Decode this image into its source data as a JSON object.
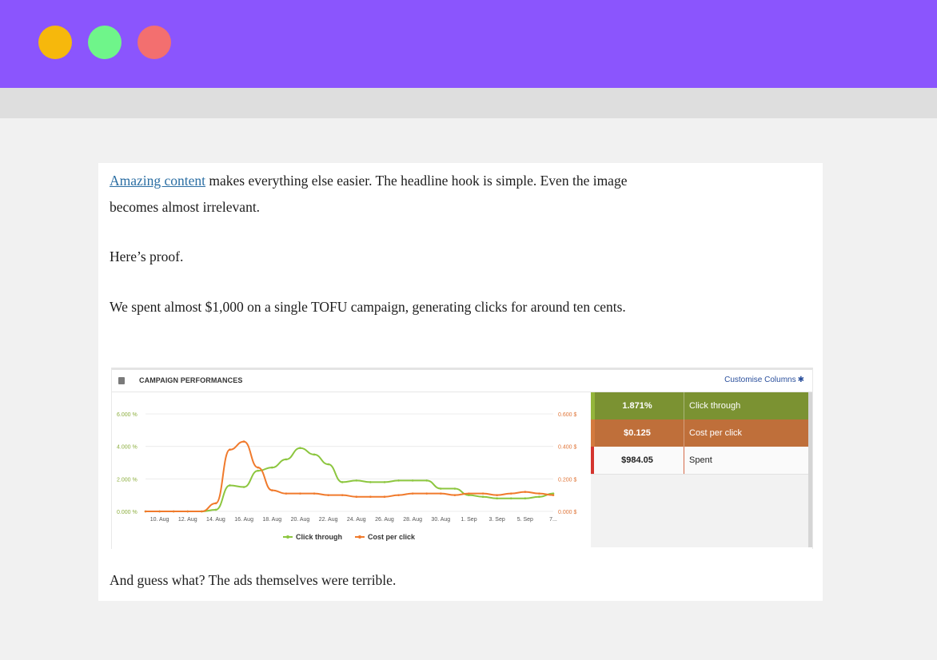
{
  "window": {
    "colors": {
      "titlebar": "#8b55fd",
      "dot_yellow": "#f6b80c",
      "dot_green": "#6ff58a",
      "dot_red": "#f36f6f",
      "toolbar": "#dedede",
      "page": "#f1f1f1"
    }
  },
  "article": {
    "p1_link": "Amazing content",
    "p1_rest": " makes everything else easier. The headline hook is simple. Even the image becomes almost irrelevant.",
    "p2": "Here’s proof.",
    "p3": "We spent almost $1,000 on a single TOFU campaign, generating clicks for around ten cents.",
    "p4": "And guess what? The ads themselves were terrible."
  },
  "widget": {
    "title": "CAMPAIGN PERFORMANCES",
    "customise_label": "Customise Columns",
    "icons": {
      "facebook": "facebook-icon",
      "gear": "gear-icon"
    },
    "metrics": [
      {
        "value": "1.871%",
        "label": "Click through",
        "color": "#7b9232"
      },
      {
        "value": "$0.125",
        "label": "Cost per click",
        "color": "#bf6f3a"
      },
      {
        "value": "$984.05",
        "label": "Spent",
        "color": "#fafafa"
      }
    ]
  },
  "chart_data": {
    "type": "line",
    "x": [
      "9 Aug",
      "10 Aug",
      "11 Aug",
      "12 Aug",
      "13 Aug",
      "14 Aug",
      "15 Aug",
      "16 Aug",
      "17 Aug",
      "18 Aug",
      "19 Aug",
      "20 Aug",
      "21 Aug",
      "22 Aug",
      "23 Aug",
      "24 Aug",
      "25 Aug",
      "26 Aug",
      "27 Aug",
      "28 Aug",
      "29 Aug",
      "30 Aug",
      "31 Aug",
      "1 Sep",
      "2 Sep",
      "3 Sep",
      "4 Sep",
      "5 Sep",
      "6 Sep",
      "7 Sep"
    ],
    "tick_labels": [
      "10. Aug",
      "12. Aug",
      "14. Aug",
      "16. Aug",
      "18. Aug",
      "20. Aug",
      "22. Aug",
      "24. Aug",
      "26. Aug",
      "28. Aug",
      "30. Aug",
      "1. Sep",
      "3. Sep",
      "5. Sep",
      "7..."
    ],
    "y_left_ticks": [
      "0.000 %",
      "2.000 %",
      "4.000 %",
      "6.000 %"
    ],
    "y_right_ticks": [
      "0.000 $",
      "0.200 $",
      "0.400 $",
      "0.600 $"
    ],
    "ylim_left": [
      0,
      6
    ],
    "ylim_right": [
      0,
      0.6
    ],
    "grid": true,
    "legend_position": "bottom-center",
    "series": [
      {
        "name": "Click through",
        "axis": "left",
        "color": "#8cc63f",
        "values": [
          0,
          0,
          0,
          0,
          0,
          0.1,
          1.6,
          1.5,
          2.5,
          2.7,
          3.2,
          3.9,
          3.5,
          2.9,
          1.8,
          1.9,
          1.8,
          1.8,
          1.9,
          1.9,
          1.9,
          1.4,
          1.4,
          1.0,
          0.9,
          0.8,
          0.8,
          0.8,
          0.9,
          1.1
        ]
      },
      {
        "name": "Cost per click",
        "axis": "right",
        "color": "#f07a2c",
        "values": [
          0,
          0,
          0,
          0,
          0,
          0.05,
          0.38,
          0.43,
          0.27,
          0.13,
          0.11,
          0.11,
          0.11,
          0.1,
          0.1,
          0.09,
          0.09,
          0.09,
          0.1,
          0.11,
          0.11,
          0.11,
          0.1,
          0.11,
          0.11,
          0.1,
          0.11,
          0.12,
          0.11,
          0.1
        ]
      }
    ]
  }
}
